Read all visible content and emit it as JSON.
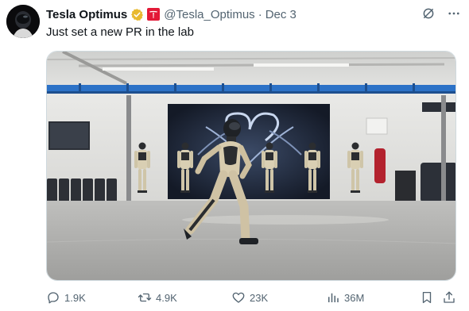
{
  "tweet": {
    "author_name": "Tesla Optimus",
    "handle": "@Tesla_Optimus",
    "separator": "·",
    "date": "Dec 3",
    "text": "Just set a new PR in the lab"
  },
  "icons": {
    "verified": "verified-badge-icon",
    "affiliate": "tesla-affiliate-badge-icon",
    "grok": "grok-icon",
    "more": "more-icon",
    "reply": "reply-icon",
    "retweet": "retweet-icon",
    "like": "heart-icon",
    "views": "views-icon",
    "bookmark": "bookmark-icon",
    "share": "share-icon"
  },
  "metrics": {
    "replies": "1.9K",
    "retweets": "4.9K",
    "likes": "23K",
    "views": "36M"
  },
  "colors": {
    "text": "#0f1419",
    "secondary": "#536471",
    "verified_gold": "#e8b92f",
    "tesla_red": "#e31937"
  }
}
